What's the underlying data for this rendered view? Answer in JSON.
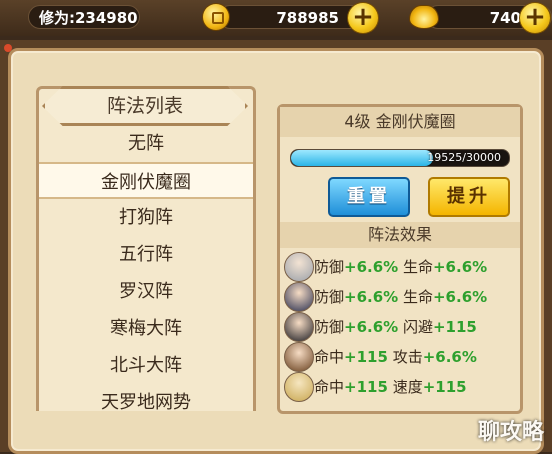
{
  "topbar": {
    "power_label": "修为:234980",
    "coins": "788985",
    "gold": "740",
    "plus_symbol": "+",
    "coin_icon": "copper-coin-icon",
    "gold_icon": "gold-ingot-icon"
  },
  "formation_list": {
    "title": "阵法列表",
    "items": [
      "无阵",
      "金刚伏魔圈",
      "打狗阵",
      "五行阵",
      "罗汉阵",
      "寒梅大阵",
      "北斗大阵",
      "天罗地网势"
    ],
    "selected_index": 1
  },
  "detail": {
    "title": "4级 金刚伏魔圈",
    "progress_text": "19525/30000",
    "progress_fraction": 0.65,
    "reset_label": "重置",
    "upgrade_label": "提升",
    "effects_title": "阵法效果",
    "effects": [
      {
        "avatar": "hero-avatar-1",
        "stats": [
          {
            "name": "防御",
            "value": "+6.6%"
          },
          {
            "name": "生命",
            "value": "+6.6%"
          }
        ]
      },
      {
        "avatar": "hero-avatar-2",
        "stats": [
          {
            "name": "防御",
            "value": "+6.6%"
          },
          {
            "name": "生命",
            "value": "+6.6%"
          }
        ]
      },
      {
        "avatar": "hero-avatar-3",
        "stats": [
          {
            "name": "防御",
            "value": "+6.6%"
          },
          {
            "name": "闪避",
            "value": "+115"
          }
        ]
      },
      {
        "avatar": "hero-avatar-4",
        "stats": [
          {
            "name": "命中",
            "value": "+115"
          },
          {
            "name": "攻击",
            "value": "+6.6%"
          }
        ]
      },
      {
        "avatar": "hero-avatar-5",
        "stats": [
          {
            "name": "命中",
            "value": "+115"
          },
          {
            "name": "速度",
            "value": "+115"
          }
        ]
      }
    ]
  },
  "watermark": "聊攻略"
}
